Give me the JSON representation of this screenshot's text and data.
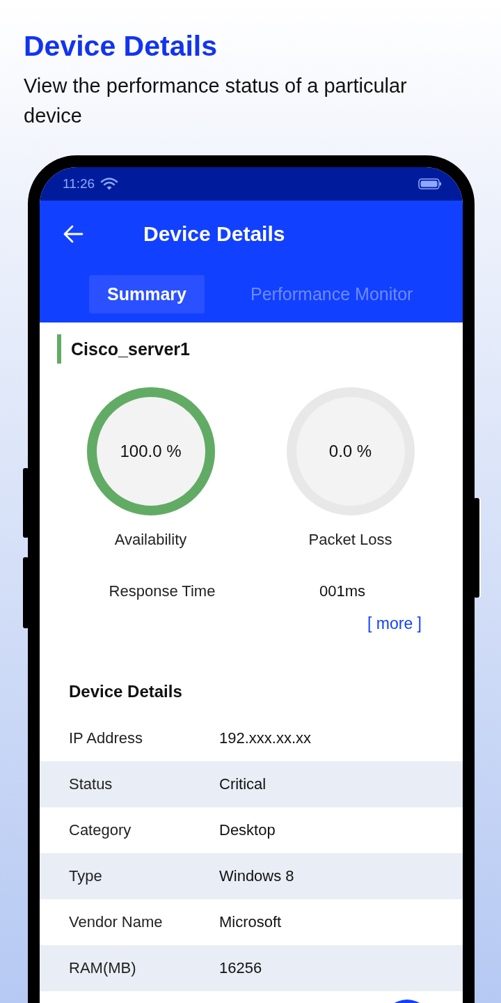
{
  "page": {
    "title": "Device Details",
    "subtitle": "View the performance status of a particular device"
  },
  "status_bar": {
    "time": "11:26"
  },
  "app_bar": {
    "title": "Device Details"
  },
  "tabs": [
    {
      "label": "Summary",
      "selected": true
    },
    {
      "label": "Performance Monitor",
      "selected": false
    }
  ],
  "device": {
    "name": "Cisco_server1"
  },
  "gauges": [
    {
      "label": "Availability",
      "reading": "100.0 %",
      "level": 1
    },
    {
      "label": "Packet Loss",
      "reading": "0.0 %",
      "level": 0
    }
  ],
  "response_time": {
    "label": "Response Time",
    "value": "001ms"
  },
  "more_link": "[ more ]",
  "details": {
    "title": "Device Details",
    "rows": [
      {
        "label": "IP Address",
        "value": "192.xxx.xx.xx"
      },
      {
        "label": "Status",
        "value": "Critical"
      },
      {
        "label": "Category",
        "value": "Desktop"
      },
      {
        "label": "Type",
        "value": "Windows 8"
      },
      {
        "label": "Vendor Name",
        "value": "Microsoft"
      },
      {
        "label": "RAM(MB)",
        "value": "16256"
      }
    ]
  }
}
